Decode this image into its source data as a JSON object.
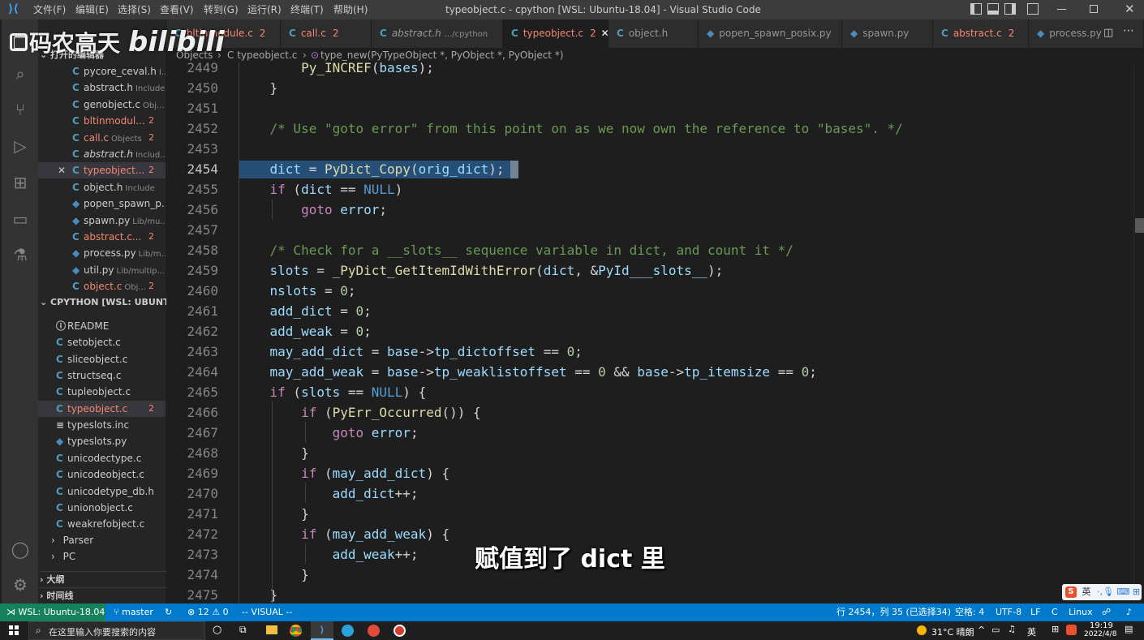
{
  "titlebar": {
    "menus": [
      "文件(F)",
      "编辑(E)",
      "选择(S)",
      "查看(V)",
      "转到(G)",
      "运行(R)",
      "终端(T)",
      "帮助(H)"
    ],
    "title": "typeobject.c - cpython [WSL: Ubuntu-18.04] - Visual Studio Code"
  },
  "tabs": [
    {
      "icon": "C",
      "label": "bltinmodule.c",
      "count": "2",
      "state": "err"
    },
    {
      "icon": "C",
      "label": "call.c",
      "count": "2",
      "state": "err"
    },
    {
      "icon": "C",
      "label": "abstract.h",
      "desc": ".../cpython",
      "state": "italic"
    },
    {
      "icon": "C",
      "label": "typeobject.c",
      "count": "2",
      "state": "active"
    },
    {
      "icon": "C",
      "label": "object.h",
      "state": "normal"
    },
    {
      "icon": "py",
      "label": "popen_spawn_posix.py",
      "state": "normal"
    },
    {
      "icon": "py",
      "label": "spawn.py",
      "state": "normal"
    },
    {
      "icon": "C",
      "label": "abstract.c",
      "count": "2",
      "state": "err"
    },
    {
      "icon": "py",
      "label": "process.py",
      "state": "normal"
    }
  ],
  "breadcrumb": {
    "parts": [
      "Objects",
      "C typeobject.c",
      "type_new(PyTypeObject *, PyObject *, PyObject *)"
    ]
  },
  "sidebar": {
    "open_editors_header": "打开的编辑器",
    "open_editors": [
      {
        "label": "pycore_ceval.h",
        "desc": "I...",
        "count": ""
      },
      {
        "label": "abstract.h",
        "desc": "Include",
        "count": ""
      },
      {
        "label": "genobject.c",
        "desc": "Obj...",
        "count": ""
      },
      {
        "label": "bltinmodul...",
        "desc": "",
        "count": "2"
      },
      {
        "label": "call.c",
        "desc": "Objects",
        "count": "2"
      },
      {
        "label": "abstract.h",
        "desc": "Includ...",
        "count": ""
      },
      {
        "label": "typeobject...",
        "desc": "",
        "count": "2"
      },
      {
        "label": "object.h",
        "desc": "Include",
        "count": ""
      },
      {
        "label": "popen_spawn_p...",
        "desc": "",
        "count": ""
      },
      {
        "label": "spawn.py",
        "desc": "Lib/mu...",
        "count": ""
      },
      {
        "label": "abstract.c...",
        "desc": "",
        "count": "2"
      },
      {
        "label": "process.py",
        "desc": "Lib/m...",
        "count": ""
      },
      {
        "label": "util.py",
        "desc": "Lib/multip...",
        "count": ""
      },
      {
        "label": "object.c",
        "desc": "Obj...",
        "count": "2"
      }
    ],
    "workspace_header": "CPYTHON [WSL: UBUNTU-...",
    "files": [
      {
        "label": "README",
        "count": ""
      },
      {
        "label": "setobject.c",
        "count": ""
      },
      {
        "label": "sliceobject.c",
        "count": ""
      },
      {
        "label": "structseq.c",
        "count": ""
      },
      {
        "label": "tupleobject.c",
        "count": ""
      },
      {
        "label": "typeobject.c",
        "count": "2"
      },
      {
        "label": "typeslots.inc",
        "count": ""
      },
      {
        "label": "typeslots.py",
        "count": ""
      },
      {
        "label": "unicodectype.c",
        "count": ""
      },
      {
        "label": "unicodeobject.c",
        "count": ""
      },
      {
        "label": "unicodetype_db.h",
        "count": ""
      },
      {
        "label": "unionobject.c",
        "count": ""
      },
      {
        "label": "weakrefobject.c",
        "count": ""
      }
    ],
    "folders": [
      "Parser",
      "PC"
    ],
    "outline_header": "大纲",
    "timeline_header": "时间线"
  },
  "editor": {
    "current_line": "2454",
    "lines": [
      {
        "n": "2449",
        "text": "        Py_INCREF(bases);"
      },
      {
        "n": "2450",
        "text": "    }"
      },
      {
        "n": "2451",
        "text": ""
      },
      {
        "n": "2452",
        "text": "    /* Use \"goto error\" from this point on as we now own the reference to \"bases\". */"
      },
      {
        "n": "2453",
        "text": ""
      },
      {
        "n": "2454",
        "text": "    dict = PyDict_Copy(orig_dict);"
      },
      {
        "n": "2455",
        "text": "    if (dict == NULL)"
      },
      {
        "n": "2456",
        "text": "        goto error;"
      },
      {
        "n": "2457",
        "text": ""
      },
      {
        "n": "2458",
        "text": "    /* Check for a __slots__ sequence variable in dict, and count it */"
      },
      {
        "n": "2459",
        "text": "    slots = _PyDict_GetItemIdWithError(dict, &PyId___slots__);"
      },
      {
        "n": "2460",
        "text": "    nslots = 0;"
      },
      {
        "n": "2461",
        "text": "    add_dict = 0;"
      },
      {
        "n": "2462",
        "text": "    add_weak = 0;"
      },
      {
        "n": "2463",
        "text": "    may_add_dict = base->tp_dictoffset == 0;"
      },
      {
        "n": "2464",
        "text": "    may_add_weak = base->tp_weaklistoffset == 0 && base->tp_itemsize == 0;"
      },
      {
        "n": "2465",
        "text": "    if (slots == NULL) {"
      },
      {
        "n": "2466",
        "text": "        if (PyErr_Occurred()) {"
      },
      {
        "n": "2467",
        "text": "            goto error;"
      },
      {
        "n": "2468",
        "text": "        }"
      },
      {
        "n": "2469",
        "text": "        if (may_add_dict) {"
      },
      {
        "n": "2470",
        "text": "            add_dict++;"
      },
      {
        "n": "2471",
        "text": "        }"
      },
      {
        "n": "2472",
        "text": "        if (may_add_weak) {"
      },
      {
        "n": "2473",
        "text": "            add_weak++;"
      },
      {
        "n": "2474",
        "text": "        }"
      },
      {
        "n": "2475",
        "text": "    }"
      }
    ]
  },
  "statusbar": {
    "remote": "WSL: Ubuntu-18.04",
    "branch": "master",
    "errors": "12",
    "warnings": "0",
    "mode": "-- VISUAL --",
    "position": "行 2454，列 35 (已选择34)",
    "spaces": "空格: 4",
    "encoding": "UTF-8",
    "eol": "LF",
    "language": "C",
    "platform": "Linux"
  },
  "taskbar": {
    "search_placeholder": "在这里输入你要搜索的内容",
    "weather": "31°C 晴朗",
    "ime": "英",
    "time": "19:19",
    "date": "2022/4/8"
  },
  "overlay": {
    "subtitle": "赋值到了 dict 里",
    "watermark": "码农高天"
  },
  "colors": {
    "accent": "#007acc",
    "selection": "#264f78",
    "keyword": "#c586c0",
    "type": "#4ec9b0",
    "function": "#dcdcaa",
    "variable": "#9cdcfe",
    "comment": "#6a9955",
    "number": "#b5cea8"
  }
}
